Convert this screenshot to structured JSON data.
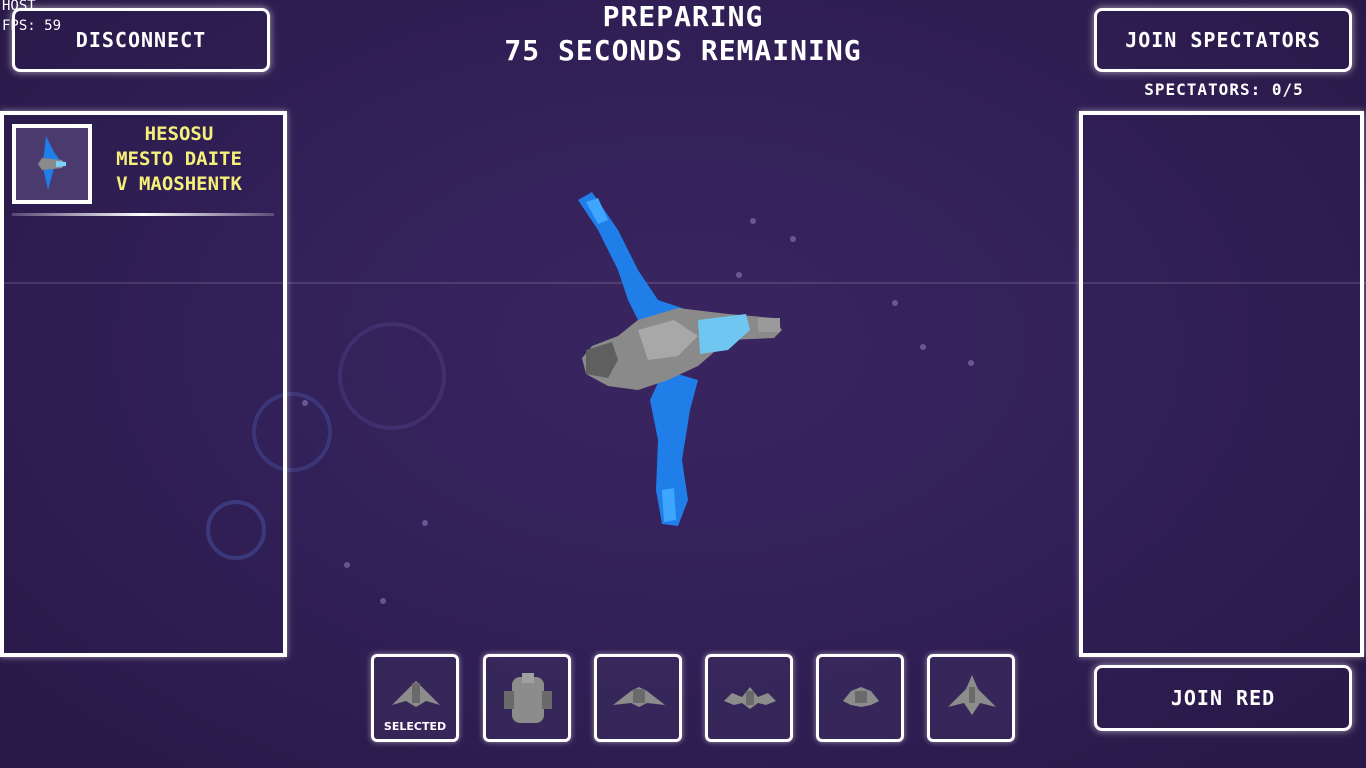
{
  "hud": {
    "host": "HOST",
    "fps": "FPS: 59"
  },
  "status": {
    "phase": "PREPARING",
    "countdown": "75 SECONDS REMAINING"
  },
  "buttons": {
    "disconnect": "DISCONNECT",
    "join_spectators": "JOIN SPECTATORS",
    "join_red": "JOIN RED"
  },
  "spectators": {
    "count_label": "SPECTATORS: 0/5"
  },
  "blue_team": {
    "players": [
      {
        "name_line1": "HESOSU",
        "name_line2": "MESTO DAITE",
        "name_line3": "V MAOSHENTK",
        "ship_icon": "blue-ship-icon"
      }
    ]
  },
  "ship_slots": [
    {
      "icon": "fighter-ship-icon",
      "label": "SELECTED"
    },
    {
      "icon": "heavy-ship-icon",
      "label": ""
    },
    {
      "icon": "bomber-ship-icon",
      "label": ""
    },
    {
      "icon": "interceptor-ship-icon",
      "label": ""
    },
    {
      "icon": "scout-ship-icon",
      "label": ""
    },
    {
      "icon": "arrow-ship-icon",
      "label": ""
    }
  ],
  "colors": {
    "accent_yellow": "#f5f07a",
    "ship_blue": "#1f7ee8",
    "background": "#33215a"
  }
}
